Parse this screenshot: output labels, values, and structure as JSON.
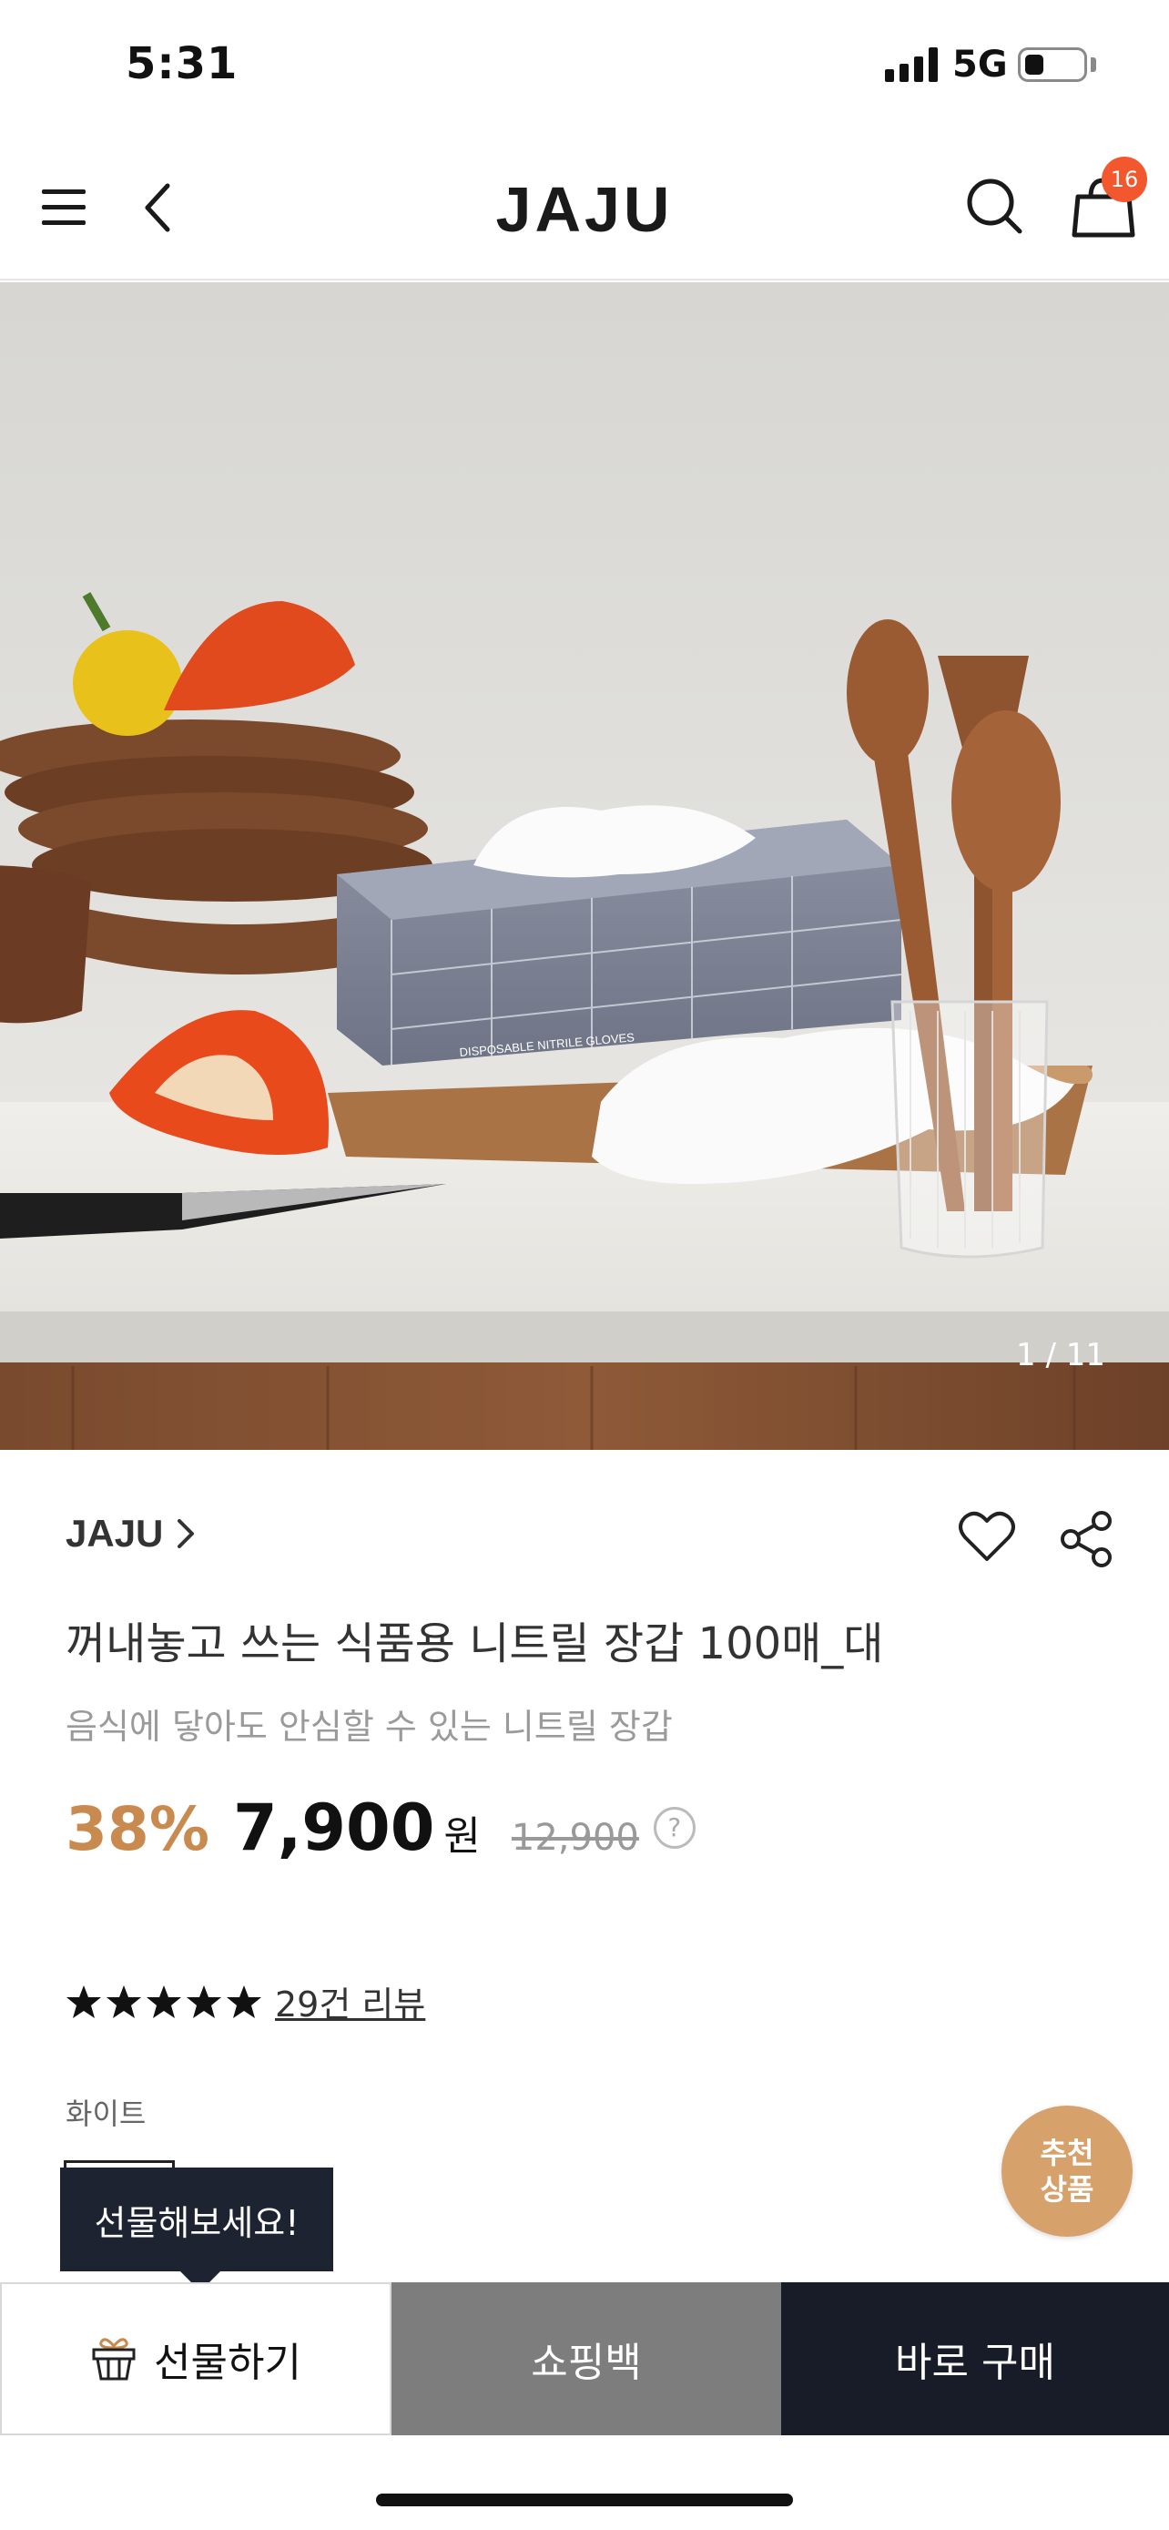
{
  "status_bar": {
    "time": "5:31",
    "network": "5G"
  },
  "header": {
    "logo": "JAJU",
    "cart_count": "16"
  },
  "hero": {
    "counter": "1 / 11",
    "box_print": "DISPOSABLE NITRILE GLOVES"
  },
  "product": {
    "brand": "JAJU",
    "title": "꺼내놓고 쓰는 식품용 니트릴 장갑 100매_대",
    "subtitle": "음식에 닿아도 안심할 수 있는 니트릴 장갑",
    "discount": "38%",
    "price": "7,900",
    "currency": "원",
    "original_price": "12,900",
    "help_symbol": "?",
    "rating_stars": 5,
    "review_text": "29건 리뷰",
    "option_label": "화이트"
  },
  "recommend": {
    "line1": "추천",
    "line2": "상품"
  },
  "tooltip": {
    "text": "선물해보세요!"
  },
  "actions": {
    "gift": "선물하기",
    "bag": "쇼핑백",
    "buy": "바로 구매"
  },
  "colors": {
    "discount": "#c98a4f",
    "buy_bg": "#171c28",
    "bag_bg": "#7d7d7d",
    "badge": "#f2572d",
    "recommend_bg": "#d7a16b"
  }
}
